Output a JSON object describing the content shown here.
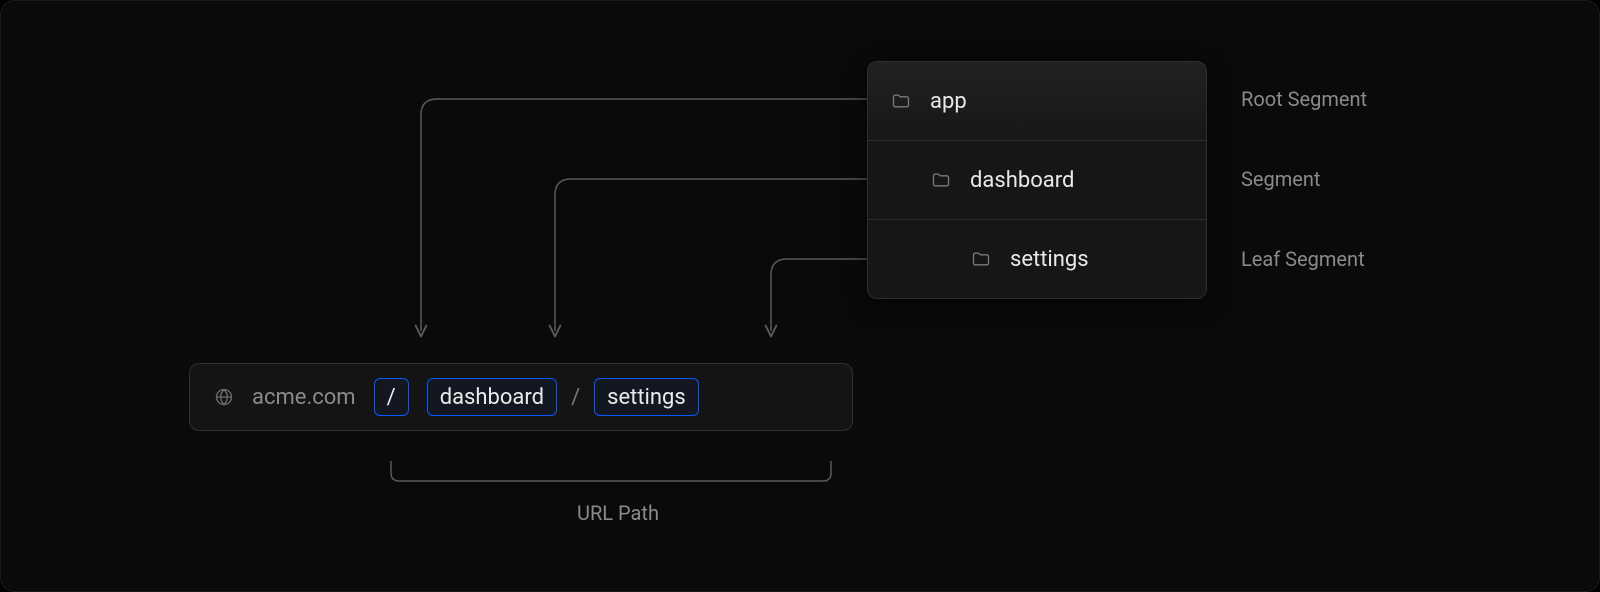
{
  "tree": {
    "items": [
      {
        "name": "app",
        "label": "Root Segment"
      },
      {
        "name": "dashboard",
        "label": "Segment"
      },
      {
        "name": "settings",
        "label": "Leaf Segment"
      }
    ]
  },
  "url": {
    "domain": "acme.com",
    "segments": [
      {
        "text": "/"
      },
      {
        "text": "dashboard"
      },
      {
        "text": "settings"
      }
    ],
    "path_label": "URL Path"
  }
}
